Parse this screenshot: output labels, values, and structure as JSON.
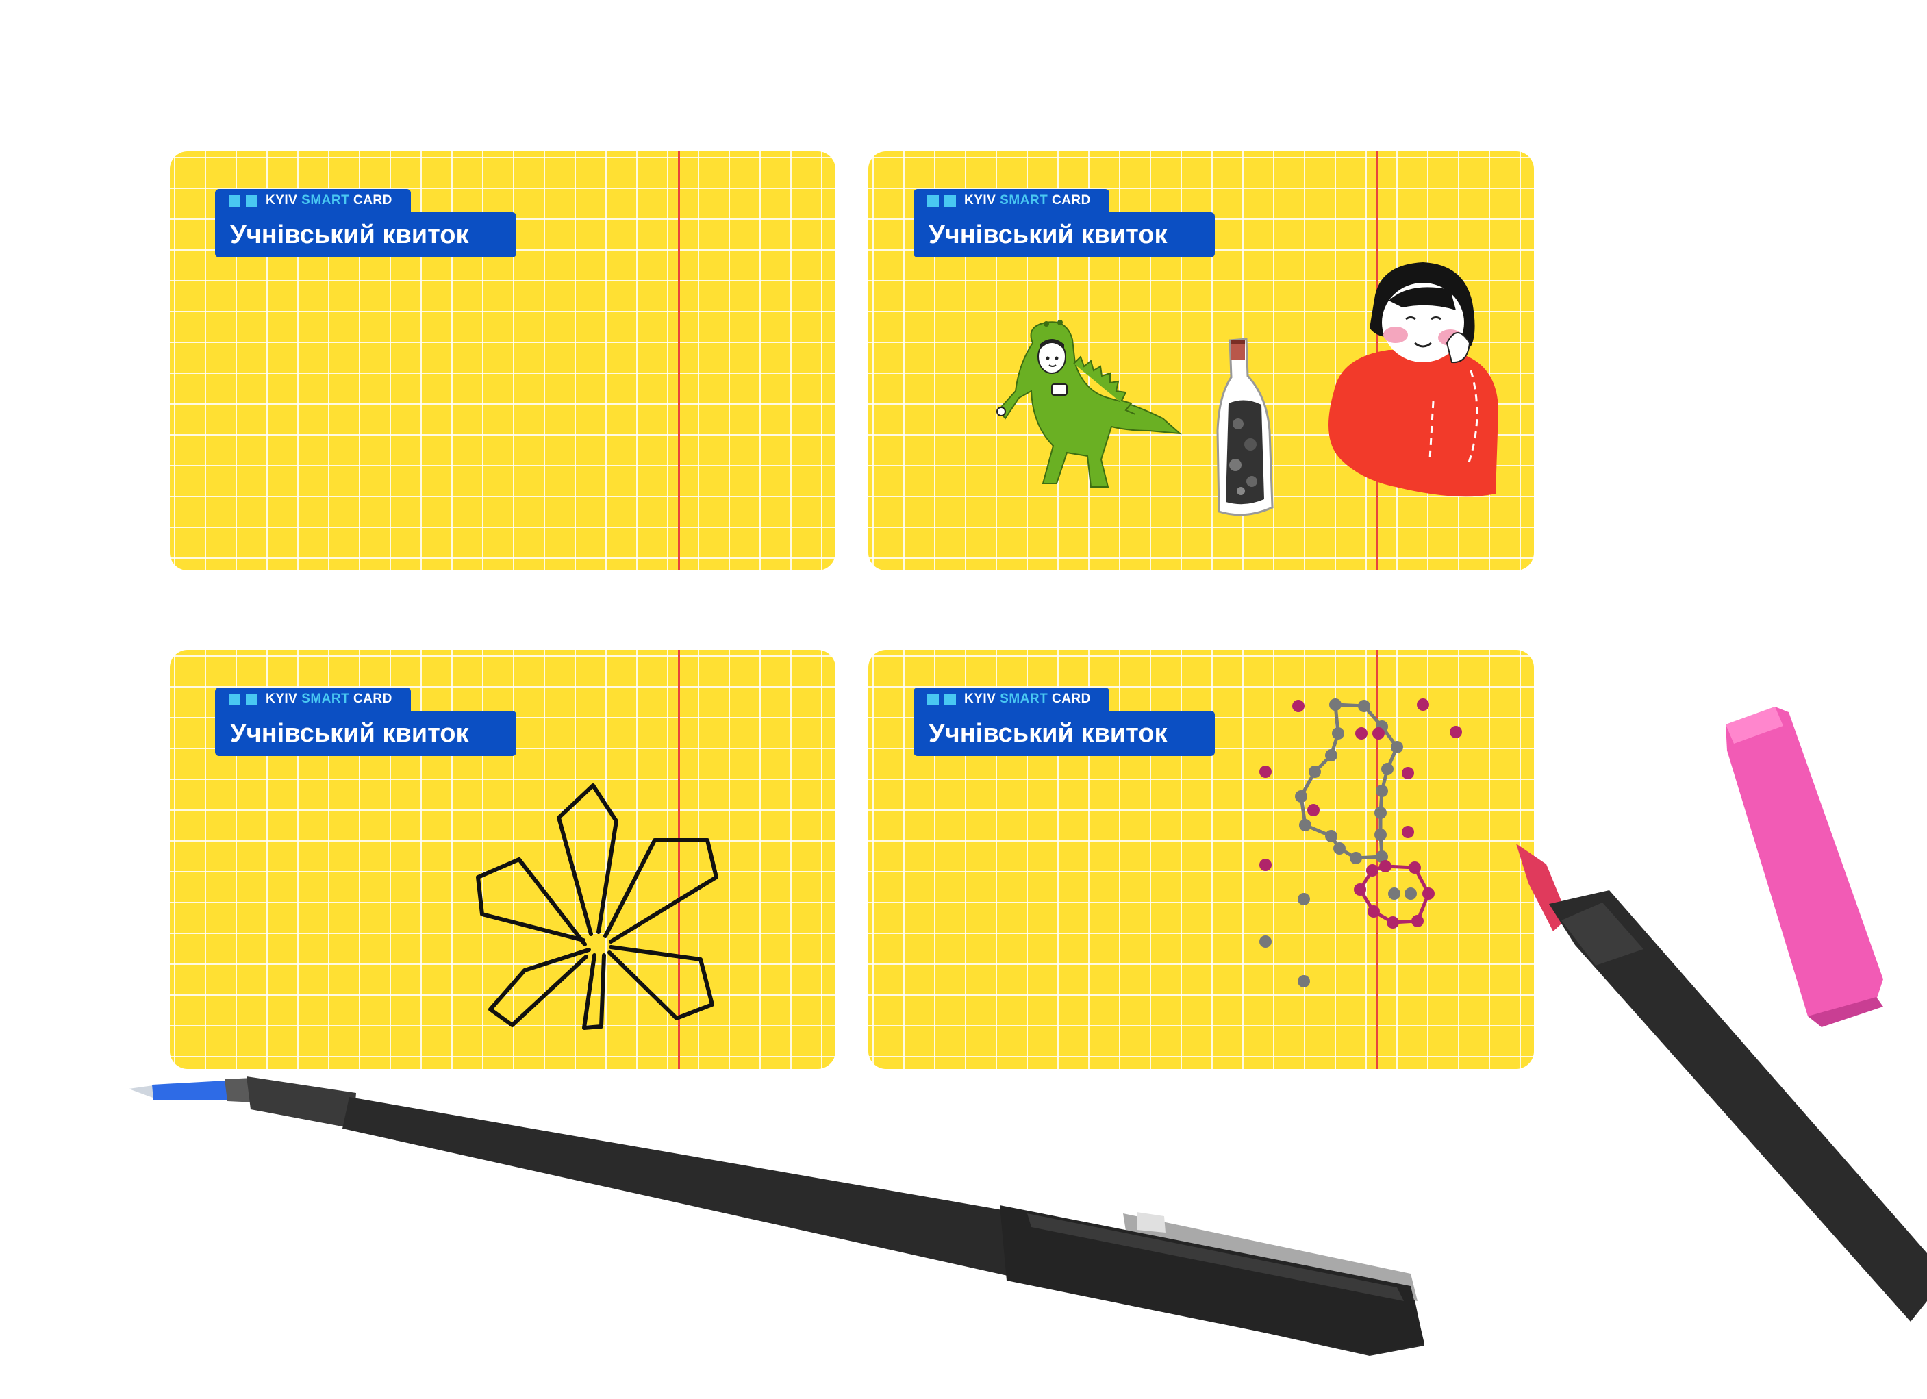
{
  "brand": {
    "kyiv": "KYIV",
    "smart": "SMART",
    "card": "CARD",
    "title": "Учнівський квиток"
  },
  "colors": {
    "card_yellow": "#FFE033",
    "brand_blue": "#0B4FC3",
    "brand_cyan": "#49C8F2",
    "margin_red": "#E8453C",
    "dot_magenta": "#B0246A",
    "dot_gray": "#76787A",
    "marker_pink": "#F25BB5"
  },
  "cards": [
    {
      "design": "blank"
    },
    {
      "design": "dinosaur-bottle-girl-illustration"
    },
    {
      "design": "chestnut-leaf-drawing"
    },
    {
      "design": "connect-the-dots-drawing"
    }
  ],
  "objects": [
    "black-pen",
    "pink-marker",
    "pink-marker-cap"
  ]
}
